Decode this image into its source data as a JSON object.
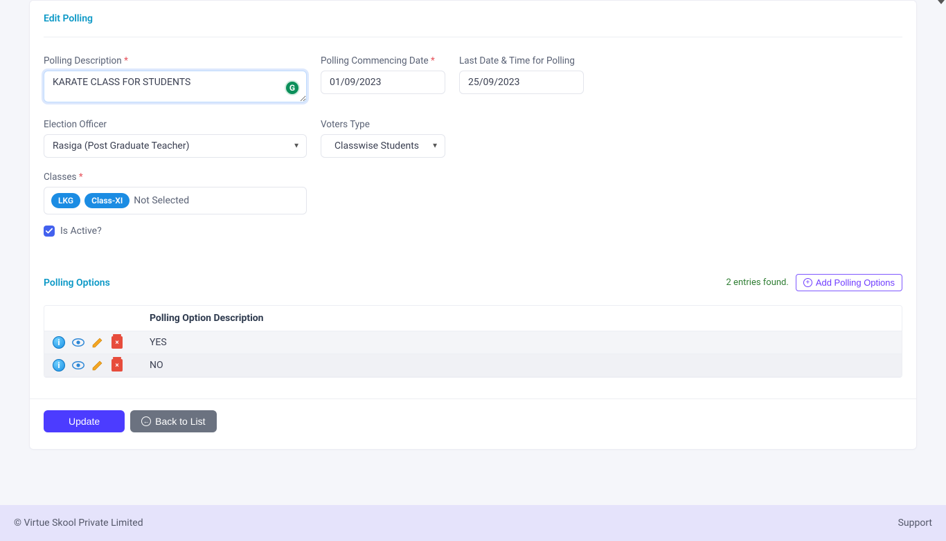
{
  "section": {
    "edit_title": "Edit Polling",
    "options_title": "Polling Options"
  },
  "labels": {
    "description": "Polling Description",
    "commencing": "Polling Commencing Date",
    "last_date": "Last Date & Time for Polling",
    "officer": "Election Officer",
    "voters_type": "Voters Type",
    "classes": "Classes",
    "is_active": "Is Active?",
    "not_selected": "Not Selected"
  },
  "form": {
    "description_value": "KARATE CLASS FOR STUDENTS",
    "commencing_value": "01/09/2023",
    "last_date_value": "25/09/2023",
    "officer_value": "Rasiga (Post Graduate Teacher)",
    "voters_type_value": "Classwise Students",
    "class_chips": [
      "LKG",
      "Class-XI"
    ],
    "is_active_checked": true
  },
  "options": {
    "entries_text": "2 entries found.",
    "add_button": "Add Polling Options",
    "column_header": "Polling Option Description",
    "rows": [
      {
        "description": "YES"
      },
      {
        "description": "NO"
      }
    ]
  },
  "actions": {
    "update": "Update",
    "back": "Back to List"
  },
  "footer": {
    "copyright": "© Virtue Skool Private Limited",
    "support": "Support"
  },
  "icons": {
    "grammarly": "G"
  }
}
